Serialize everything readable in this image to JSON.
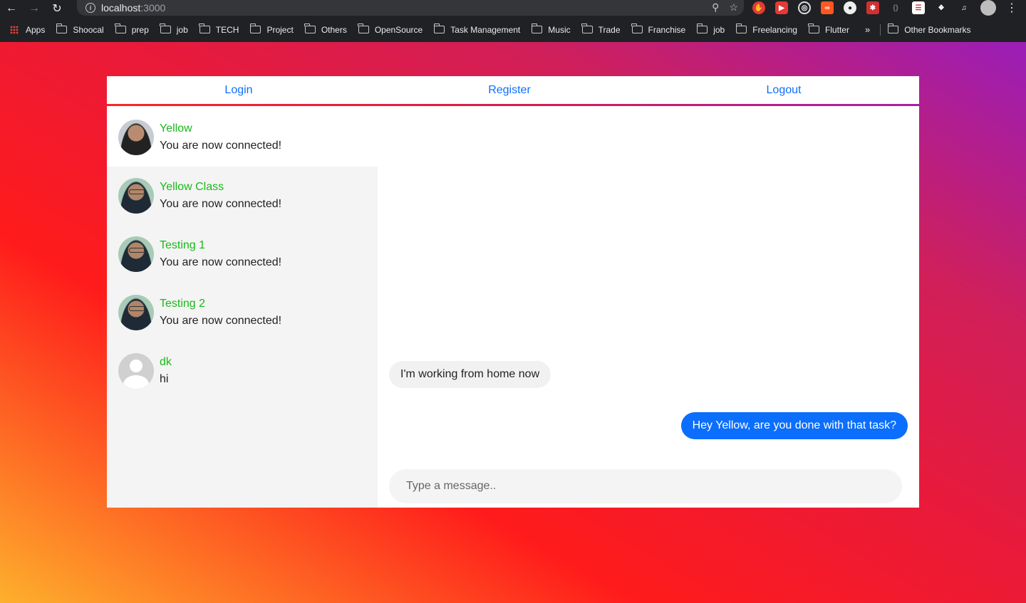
{
  "browser": {
    "url_host": "localhost",
    "url_port": ":3000",
    "bookmarks": [
      "Apps",
      "Shoocal",
      "prep",
      "job",
      "TECH",
      "Project",
      "Others",
      "OpenSource",
      "Task Management",
      "Music",
      "Trade",
      "Franchise",
      "job",
      "Freelancing",
      "Flutter"
    ],
    "more": "»",
    "other_bookmarks": "Other Bookmarks"
  },
  "nav": {
    "login": "Login",
    "register": "Register",
    "logout": "Logout"
  },
  "conversations": [
    {
      "name": "Yellow",
      "last_message": "You are now connected!",
      "avatar": "photo1",
      "active": true
    },
    {
      "name": "Yellow Class",
      "last_message": "You are now connected!",
      "avatar": "photo2",
      "active": false
    },
    {
      "name": "Testing 1",
      "last_message": "You are now connected!",
      "avatar": "photo2",
      "active": false
    },
    {
      "name": "Testing 2",
      "last_message": "You are now connected!",
      "avatar": "photo2",
      "active": false
    },
    {
      "name": "dk",
      "last_message": "hi",
      "avatar": "blank",
      "active": false
    }
  ],
  "messages": [
    {
      "direction": "in",
      "text": "I'm working from home now"
    },
    {
      "direction": "out",
      "text": "Hey Yellow, are you done with that task?"
    }
  ],
  "composer": {
    "placeholder": "Type a message.."
  },
  "colors": {
    "accent": "#0d6efd",
    "name_green": "#1ab81a",
    "outgoing_bubble": "#0b6efd"
  }
}
